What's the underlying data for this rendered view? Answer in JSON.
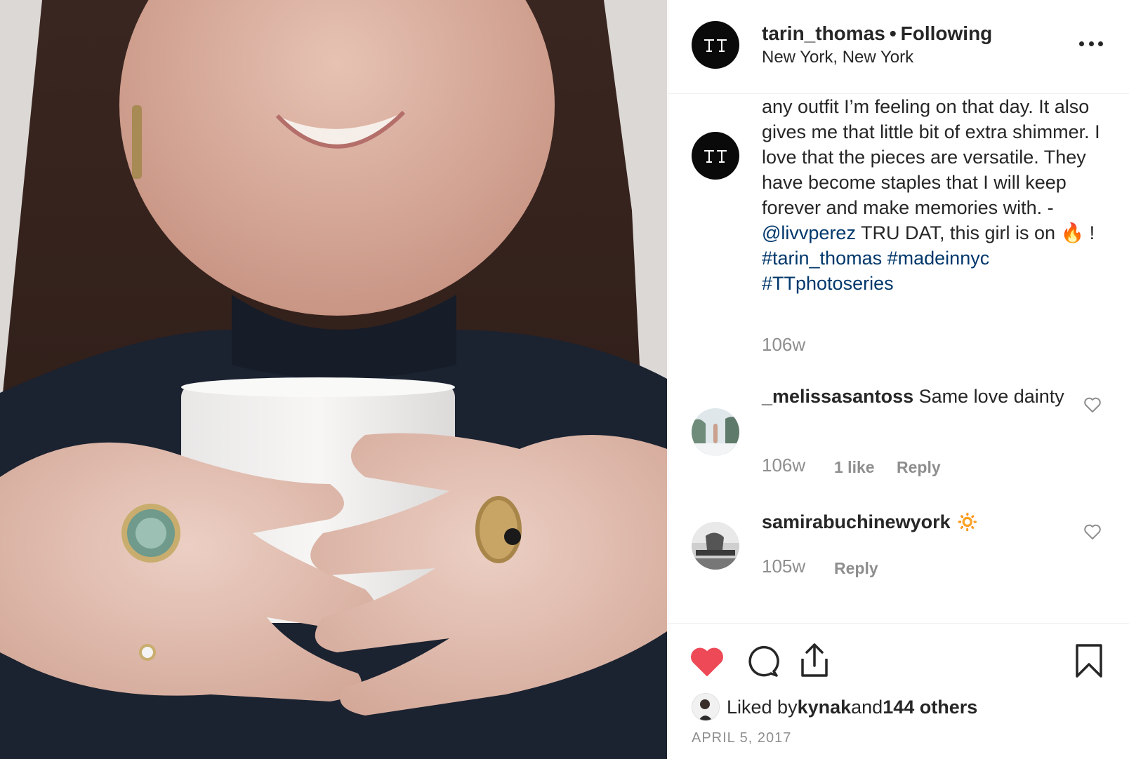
{
  "post": {
    "username": "tarin_thomas",
    "separator": "•",
    "follow_status": "Following",
    "location": "New York, New York",
    "avatar_icon": "tt-logo-icon",
    "more_icon": "more-options-icon"
  },
  "caption": {
    "text_before_mention": "any outfit I’m feeling on that day. It also gives me that little bit of extra shimmer. I love that the pieces are versatile. They have become staples that I will keep forever and make memories with. - ",
    "mention": "@livvperez",
    "text_after_mention": " TRU DAT, this girl is on ",
    "emoji": "🔥",
    "text_end": " !",
    "hashtags": [
      "#tarin_thomas",
      "#madeinnyc",
      "#TTphotoseries"
    ],
    "timestamp": "106w"
  },
  "comments": [
    {
      "username": "_melissasantoss",
      "text": " Same love dainty",
      "timestamp": "106w",
      "likes": "1 like",
      "reply_label": "Reply"
    },
    {
      "username": "samirabuchinewyork",
      "emoji": "🔅",
      "text": "",
      "timestamp": "105w",
      "reply_label": "Reply"
    }
  ],
  "actions": {
    "like_icon": "heart-filled-icon",
    "comment_icon": "comment-icon",
    "share_icon": "share-icon",
    "save_icon": "bookmark-icon",
    "like_color": "#ed4956"
  },
  "likes": {
    "prefix": "Liked by ",
    "user": "kynak",
    "middle": " and ",
    "others": "144 others"
  },
  "date": "APRIL 5, 2017",
  "colors": {
    "text": "#262626",
    "secondary": "#8e8e8e",
    "link": "#00376b",
    "border": "#efefef"
  }
}
